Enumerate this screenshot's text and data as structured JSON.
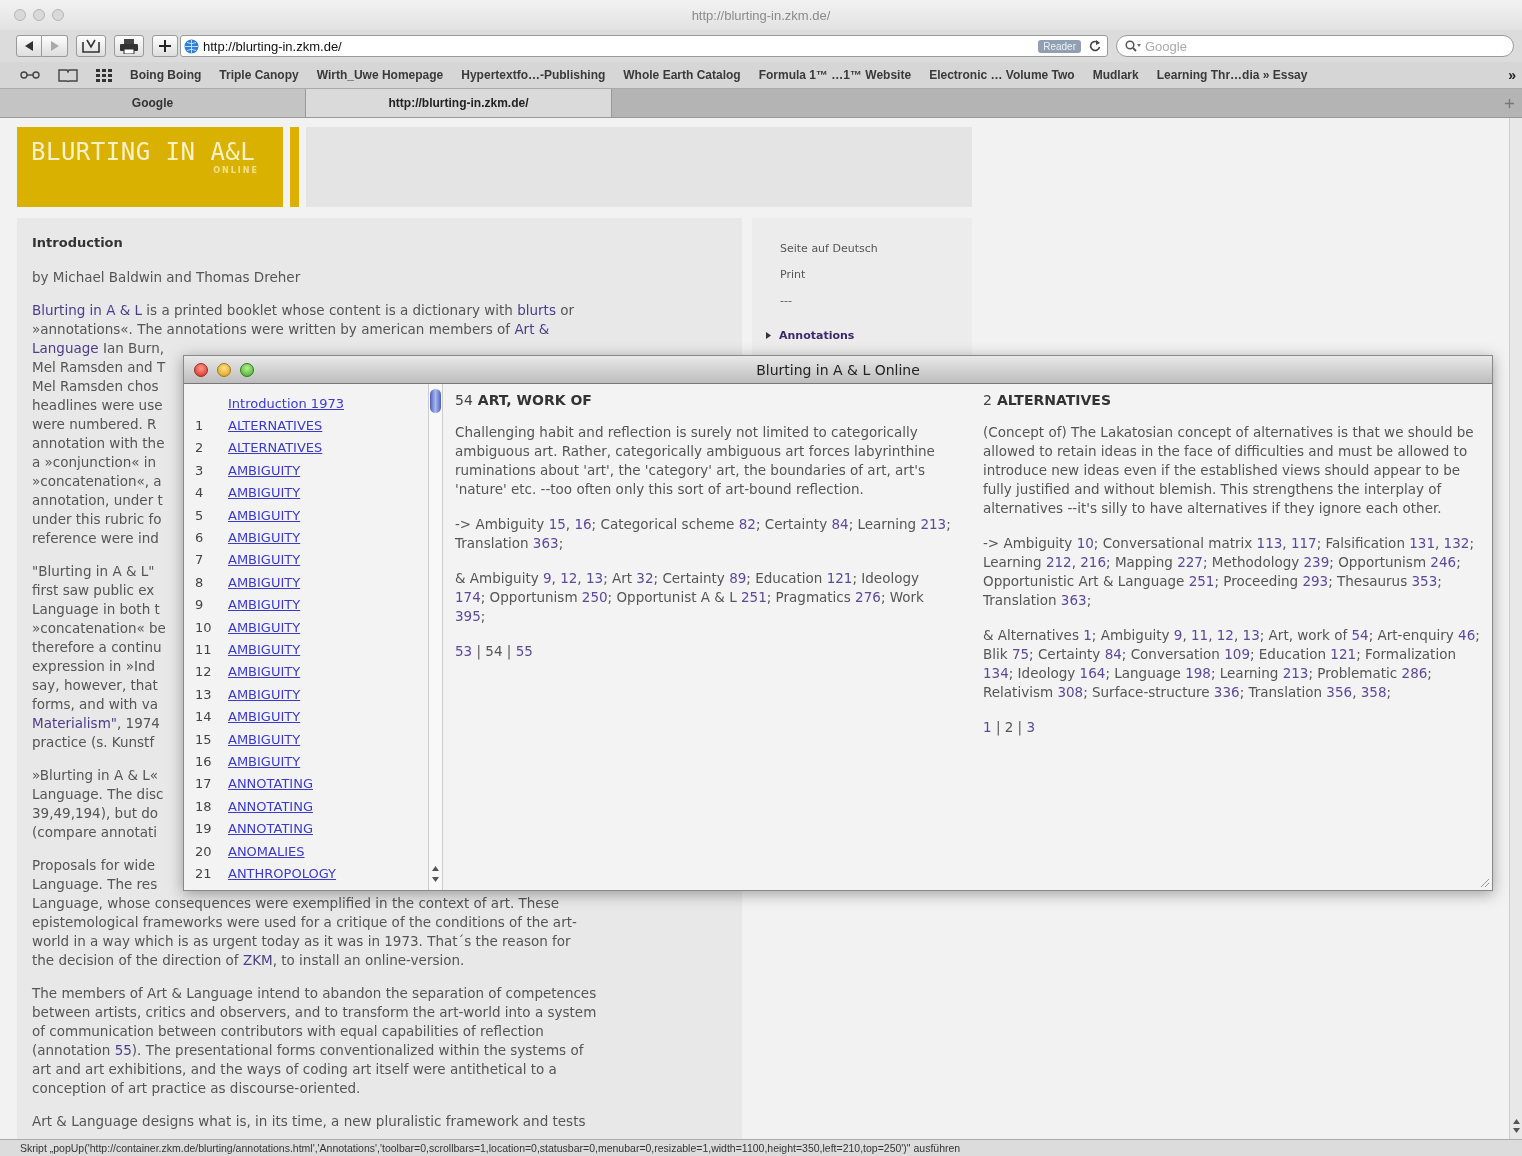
{
  "browser": {
    "title": "http://blurting-in.zkm.de/",
    "url": "http://blurting-in.zkm.de/",
    "reader_badge": "Reader",
    "search_placeholder": "Google",
    "bookmarks": [
      "Boing Boing",
      "Triple Canopy",
      "Wirth_Uwe Homepage",
      "Hypertextfo…-Publishing",
      "Whole Earth Catalog",
      "Formula 1™ …1™ Website",
      "Electronic … Volume Two",
      "Mudlark",
      "Learning Thr…dia » Essay"
    ],
    "bookmarks_overflow": "»",
    "tabs": [
      {
        "label": "Google",
        "selected": false
      },
      {
        "label": "http://blurting-in.zkm.de/",
        "selected": true
      }
    ]
  },
  "page": {
    "logo": {
      "title": "BLURTING IN A&L",
      "subtitle": "ONLINE"
    },
    "article": {
      "heading": "Introduction",
      "byline": "by Michael Baldwin and Thomas Dreher",
      "paragraphs": [
        [
          [
            {
              "link": "Blurting in A & L"
            },
            " is a printed booklet whose content is a dictionary with ",
            {
              "link": "blurts"
            },
            " or"
          ],
          [
            "»annotations«. The annotations were written by american members of ",
            {
              "link": "Art &"
            }
          ],
          [
            {
              "link": "Language"
            },
            " Ian Burn,"
          ],
          "Mel Ramsden and T",
          "Mel Ramsden chos",
          "headlines were use",
          "were numbered. R",
          "annotation with the",
          "a »conjunction« in",
          "»concatenation«, a",
          "annotation, under t",
          "under this rubric fo",
          "reference were ind"
        ],
        [
          "\"Blurting in A & L\"",
          "first saw public ex",
          "Language in both t",
          "»concatenation« be",
          "therefore a continu",
          "expression in »Ind",
          "say, however, that",
          "forms, and with va",
          [
            {
              "link": "Materialism\""
            },
            ", 1974"
          ],
          "practice (s. Kunstf"
        ],
        [
          "»Blurting in A & L«",
          "Language. The disc",
          "39,49,194), but do",
          "(compare annotati"
        ],
        [
          "Proposals for wide",
          "Language. The res",
          "Language, whose consequences were exemplified in the context of art. These",
          "epistemological frameworks were used for a critique of the conditions of the art-",
          "world in a way which is as urgent today as it was in 1973. That´s the reason for",
          [
            "the decision of the direction of ",
            {
              "link": "ZKM"
            },
            ", to install an online-version."
          ]
        ],
        [
          "The members of Art & Language intend to abandon the separation of competences",
          "between artists, critics and observers, and to transform the art-world into a system",
          "of communication between contributors with equal capabilities of reflection",
          [
            "(annotation ",
            {
              "link": "55"
            },
            "). The presentational forms conventionalized within the systems of"
          ],
          "art and art exhibitions, and the ways of coding art itself were antithetical to a",
          "conception of art practice as discourse-oriented."
        ],
        [
          "Art & Language designs what is, in its time, a new pluralistic framework and tests"
        ]
      ]
    },
    "sidebar": [
      {
        "label": "Seite auf Deutsch",
        "kind": "link"
      },
      {
        "label": "Print",
        "kind": "link"
      },
      {
        "label": "---",
        "kind": "separator"
      },
      {
        "label": "Annotations",
        "kind": "section"
      }
    ]
  },
  "popup": {
    "title": "Blurting in A & L Online",
    "index": [
      {
        "label": "Introduction 1973"
      },
      {
        "number": "1",
        "label": "ALTERNATIVES"
      },
      {
        "number": "2",
        "label": "ALTERNATIVES"
      },
      {
        "number": "3",
        "label": "AMBIGUITY"
      },
      {
        "number": "4",
        "label": "AMBIGUITY"
      },
      {
        "number": "5",
        "label": "AMBIGUITY"
      },
      {
        "number": "6",
        "label": "AMBIGUITY"
      },
      {
        "number": "7",
        "label": "AMBIGUITY"
      },
      {
        "number": "8",
        "label": "AMBIGUITY"
      },
      {
        "number": "9",
        "label": "AMBIGUITY"
      },
      {
        "number": "10",
        "label": "AMBIGUITY"
      },
      {
        "number": "11",
        "label": "AMBIGUITY"
      },
      {
        "number": "12",
        "label": "AMBIGUITY"
      },
      {
        "number": "13",
        "label": "AMBIGUITY"
      },
      {
        "number": "14",
        "label": "AMBIGUITY"
      },
      {
        "number": "15",
        "label": "AMBIGUITY"
      },
      {
        "number": "16",
        "label": "AMBIGUITY"
      },
      {
        "number": "17",
        "label": "ANNOTATING"
      },
      {
        "number": "18",
        "label": "ANNOTATING"
      },
      {
        "number": "19",
        "label": "ANNOTATING"
      },
      {
        "number": "20",
        "label": "ANOMALIES"
      },
      {
        "number": "21",
        "label": "ANTHROPOLOGY"
      }
    ],
    "entries": [
      {
        "number": "54",
        "title": "ART, WORK OF",
        "text": "Challenging habit and reflection is surely not limited to categorically ambiguous art. Rather, categorically ambiguous art forces labyrinthine ruminations about 'art', the 'category' art, the boundaries of art, art's 'nature' etc. --too often only this sort of art-bound reflection.",
        "see_also": [
          "-> Ambiguity ",
          {
            "link": "15"
          },
          ", ",
          {
            "link": "16"
          },
          "; Categorical scheme ",
          {
            "link": "82"
          },
          "; Certainty ",
          {
            "link": "84"
          },
          "; Learning ",
          {
            "link": "213"
          },
          "; Translation ",
          {
            "link": "363"
          },
          ";"
        ],
        "related": [
          "& Ambiguity ",
          {
            "link": "9"
          },
          ", ",
          {
            "link": "12"
          },
          ", ",
          {
            "link": "13"
          },
          "; Art ",
          {
            "link": "32"
          },
          "; Certainty ",
          {
            "link": "89"
          },
          "; Education ",
          {
            "link": "121"
          },
          "; Ideology ",
          {
            "link": "174"
          },
          "; Opportunism ",
          {
            "link": "250"
          },
          "; Opportunist A & L ",
          {
            "link": "251"
          },
          "; Pragmatics ",
          {
            "link": "276"
          },
          "; Work ",
          {
            "link": "395"
          },
          ";"
        ],
        "nav": [
          {
            "link": "53"
          },
          " | ",
          "54",
          " | ",
          {
            "link": "55"
          }
        ]
      },
      {
        "number": "2",
        "title": "ALTERNATIVES",
        "text": "(Concept of) The Lakatosian concept of alternatives is that we should be allowed to retain ideas in the face of difficulties and must be allowed to introduce new ideas even if the established views should appear to be fully justified and without blemish. This strengthens the interplay of alternatives --it's silly to have alternatives if they ignore each other.",
        "see_also": [
          "-> Ambiguity ",
          {
            "link": "10"
          },
          "; Conversational matrix ",
          {
            "link": "113"
          },
          ", ",
          {
            "link": "117"
          },
          "; Falsification ",
          {
            "link": "131"
          },
          ", ",
          {
            "link": "132"
          },
          "; Learning ",
          {
            "link": "212"
          },
          ", ",
          {
            "link": "216"
          },
          "; Mapping ",
          {
            "link": "227"
          },
          "; Methodology ",
          {
            "link": "239"
          },
          "; Opportunism ",
          {
            "link": "246"
          },
          "; Opportunistic Art & Language ",
          {
            "link": "251"
          },
          "; Proceeding ",
          {
            "link": "293"
          },
          "; Thesaurus ",
          {
            "link": "353"
          },
          "; Translation ",
          {
            "link": "363"
          },
          ";"
        ],
        "related": [
          "& Alternatives ",
          {
            "link": "1"
          },
          "; Ambiguity ",
          {
            "link": "9"
          },
          ", ",
          {
            "link": "11"
          },
          ", ",
          {
            "link": "12"
          },
          ", ",
          {
            "link": "13"
          },
          "; Art, work of ",
          {
            "link": "54"
          },
          "; Art-enquiry ",
          {
            "link": "46"
          },
          "; Blik ",
          {
            "link": "75"
          },
          "; Certainty ",
          {
            "link": "84"
          },
          "; Conversation ",
          {
            "link": "109"
          },
          "; Education ",
          {
            "link": "121"
          },
          "; Formalization ",
          {
            "link": "134"
          },
          "; Ideology ",
          {
            "link": "164"
          },
          "; Language ",
          {
            "link": "198"
          },
          "; Learning ",
          {
            "link": "213"
          },
          "; Problematic ",
          {
            "link": "286"
          },
          "; Relativism ",
          {
            "link": "308"
          },
          "; Surface-structure ",
          {
            "link": "336"
          },
          "; Translation ",
          {
            "link": "356"
          },
          ", ",
          {
            "link": "358"
          },
          ";"
        ],
        "nav": [
          {
            "link": "1"
          },
          " | ",
          "2",
          " | ",
          {
            "link": "3"
          }
        ]
      }
    ]
  },
  "status_bar": "Skript „popUp('http://container.zkm.de/blurting/annotations.html','Annotations','toolbar=0,scrollbars=1,location=0,statusbar=0,menubar=0,resizable=1,width=1100,height=350,left=210,top=250')\" ausführen"
}
